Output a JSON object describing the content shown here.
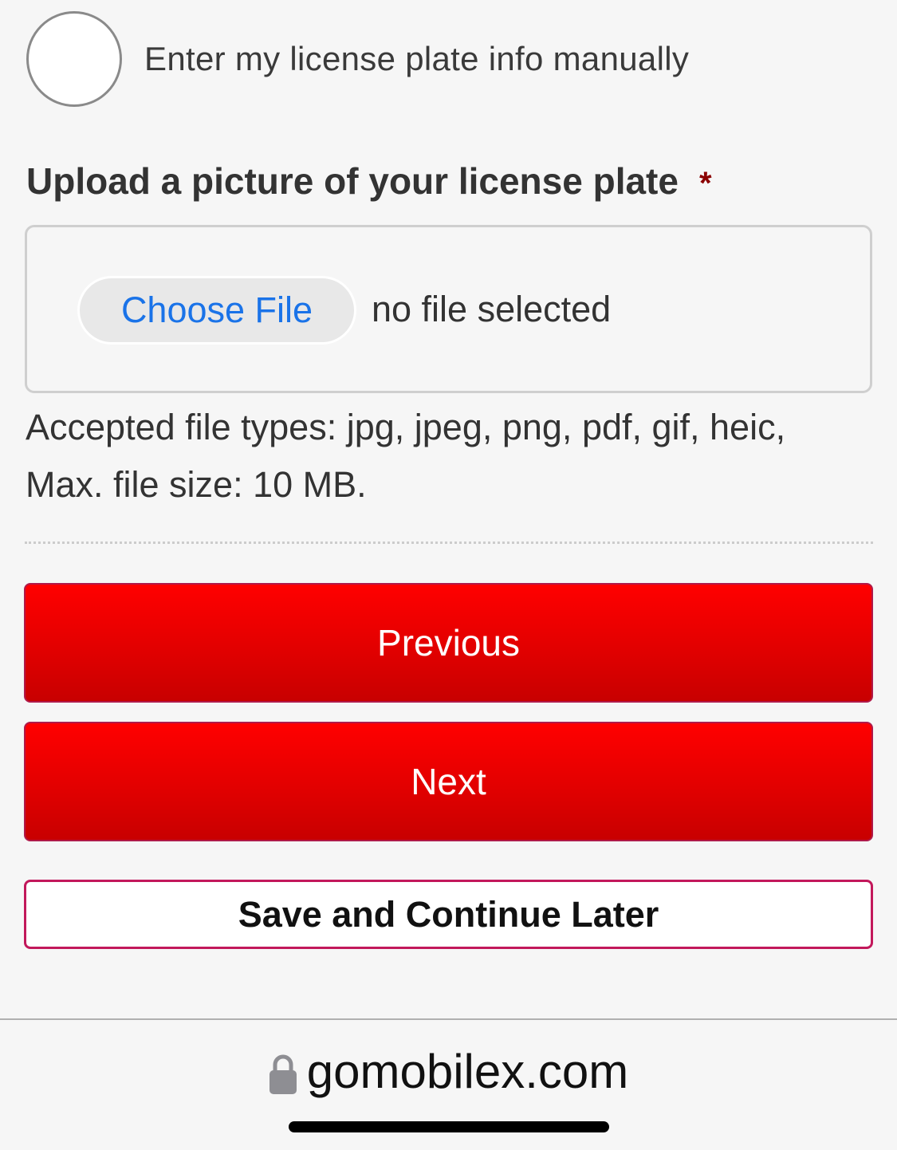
{
  "manual_option": {
    "label": "Enter my license plate info manually",
    "selected": false
  },
  "upload": {
    "label": "Upload a picture of your license plate",
    "required_marker": "*",
    "choose_file_label": "Choose File",
    "file_status": "no file selected",
    "accepted_line1": "Accepted file types: jpg, jpeg, png, pdf, gif, heic,",
    "accepted_line2": "Max. file size: 10 MB."
  },
  "buttons": {
    "previous_label": "Previous",
    "next_label": "Next",
    "save_label": "Save and Continue Later"
  },
  "browser": {
    "url": "gomobilex.com",
    "secure_icon": "lock-icon"
  },
  "colors": {
    "primary_button": "#ff0000",
    "link_blue": "#1a73e8",
    "required": "#8b0000",
    "save_border": "#c2185b"
  }
}
